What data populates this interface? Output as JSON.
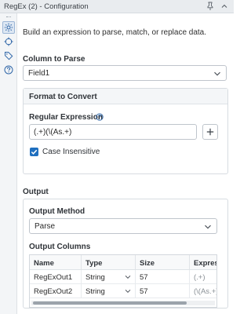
{
  "window": {
    "title": "RegEx (2) - Configuration"
  },
  "description": "Build an expression to parse, match, or replace data.",
  "column_to_parse": {
    "label": "Column to Parse",
    "value": "Field1"
  },
  "format_to_convert": {
    "heading": "Format to Convert",
    "regex_label": "Regular Expression",
    "regex_value": "(.+)(\\(As.+)",
    "case_insensitive_label": "Case Insensitive",
    "case_insensitive_checked": true
  },
  "output": {
    "heading": "Output",
    "method_label": "Output Method",
    "method_value": "Parse",
    "columns_label": "Output Columns",
    "columns_headers": [
      "Name",
      "Type",
      "Size",
      "Expressio"
    ],
    "rows": [
      {
        "name": "RegExOut1",
        "type": "String",
        "size": "57",
        "expression": "(.+)"
      },
      {
        "name": "RegExOut2",
        "type": "String",
        "size": "57",
        "expression": "(\\(As.+)"
      }
    ]
  },
  "colors": {
    "accent": "#1f6fbf",
    "icon": "#1f6fbf"
  }
}
